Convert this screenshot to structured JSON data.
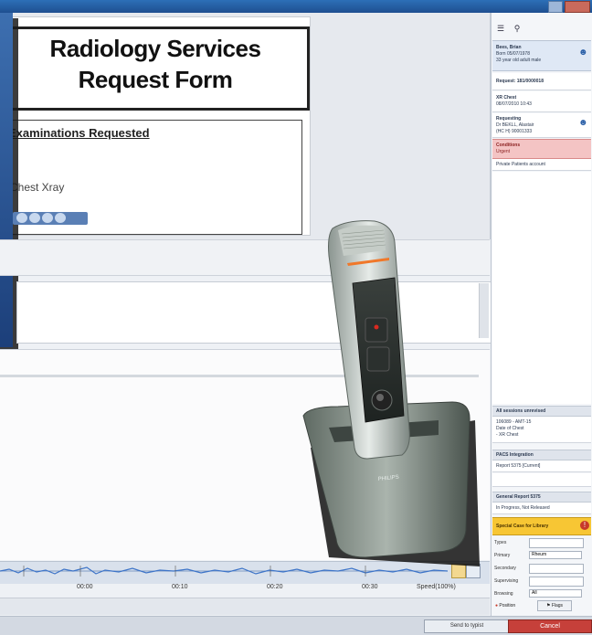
{
  "form": {
    "title_line1": "Radiology Services",
    "title_line2": "Request Form",
    "exam_heading": "Examinations Requested",
    "exam_item": "Chest Xray"
  },
  "sidebar": {
    "patient_name": "Bees, Brian",
    "patient_dob": "Born 05/07/1978",
    "patient_age": "33 year old adult male",
    "request": "Request: 181/0000018",
    "exam_title": "XR Chest",
    "exam_date": "08/07/2010 10:43",
    "requesting_label": "Requesting",
    "requesting_name": "Dr BEKLL, Alastair",
    "requesting_org": "(HC H) 90001333",
    "conditions_label": "Conditions",
    "conditions_value": "Urgent",
    "private_label": "Private Patients account",
    "all_sessions": "All sessions unrevised",
    "session_line1": "106089 - AMT-15",
    "session_line2": "Date of Chest",
    "session_line3": "- XR Chest",
    "pacs_label": "PACS Integration",
    "pacs_report": "Report 5375 [Current]",
    "general_report": "General Report 5375",
    "report_status": "In Progress, Not Released",
    "special_case": "Special Case for Library",
    "fields": [
      {
        "label": "Types",
        "value": ""
      },
      {
        "label": "Primary",
        "value": "Rheum"
      },
      {
        "label": "Secondary",
        "value": ""
      },
      {
        "label": "Supervising",
        "value": ""
      },
      {
        "label": "Browsing",
        "value": "All"
      }
    ],
    "btn_position": "Position",
    "btn_flags": "Flags"
  },
  "wave": {
    "times": [
      "00:00",
      "00:10",
      "00:20",
      "00:30"
    ],
    "speed": "Speed(100%)"
  },
  "bottom": {
    "send_typist": "Send to typist",
    "cancel": "Cancel"
  },
  "device": {
    "brand": "PHILIPS"
  }
}
